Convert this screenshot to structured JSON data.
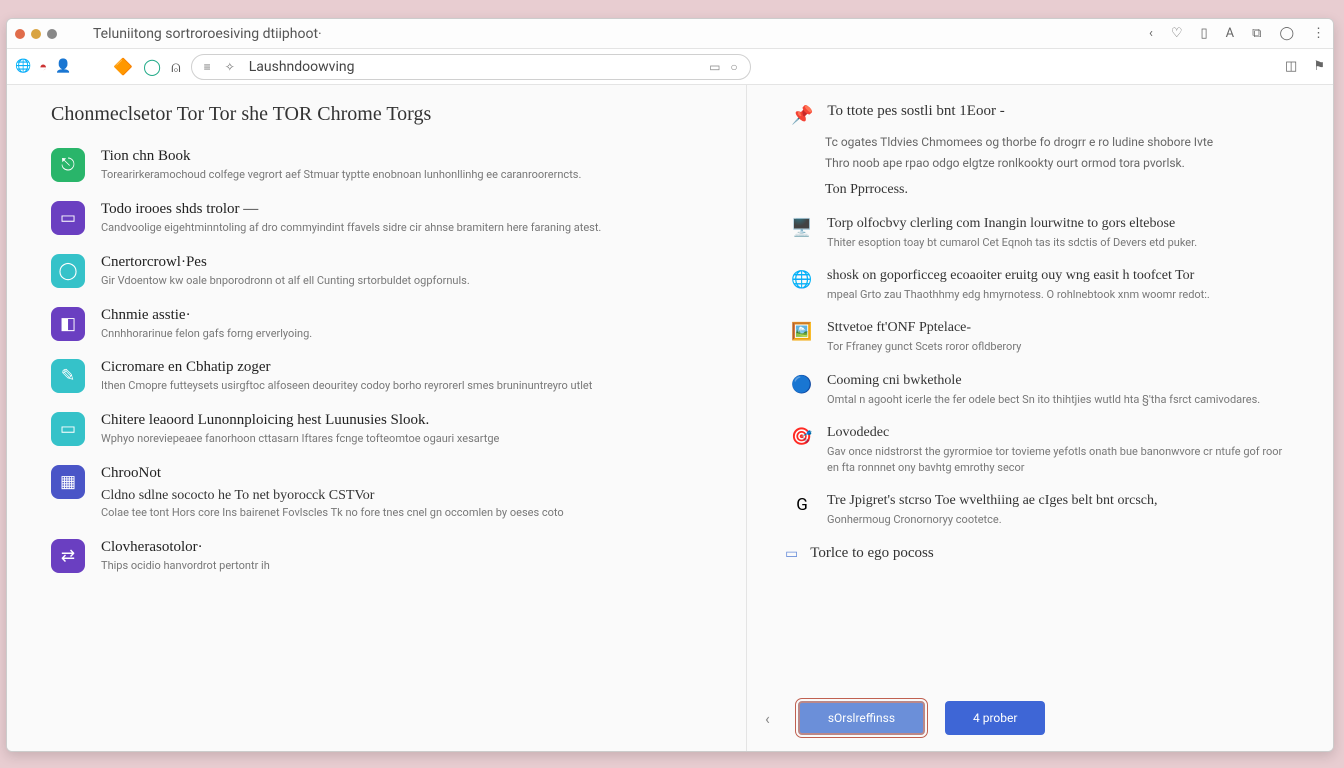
{
  "titlebar": {
    "title": "Teluniitong sortroroesiving dtiiphoot·"
  },
  "url": "Laushndoowving",
  "left": {
    "heading": "Chonmeclsetor Tor Tor she TOR Chrome Torgs",
    "items": [
      {
        "color": "#29b56a",
        "glyph": "⎋",
        "title": "Tion chn Book",
        "desc": "Torearirkeramochoud colfege vegrort aef Stmuar typtte enobnoan lunhonllinhg ee caranroorerncts."
      },
      {
        "color": "#6a3fc1",
        "glyph": "▭",
        "title": "Todo irooes shds trolor —",
        "desc": "Candvoolige eigehtminntoling af dro commyindint ffavels sidre cir ahnse bramitern here faraning atest."
      },
      {
        "color": "#35c2c9",
        "glyph": "◯",
        "title": "Cnertorcrowl·Pes",
        "desc": "Gir Vdoentow kw oale bnporodronn ot alf ell Cunting srtorbuldet ogpfornuls."
      },
      {
        "color": "#6a3fc1",
        "glyph": "◧",
        "title": "Chnmie asstie·",
        "desc": "Cnnhhorarinue felon gafs forng erverlyoing."
      },
      {
        "color": "#35c2c9",
        "glyph": "✎",
        "title": "Cicromare en Cbhatip zoger",
        "desc": "Ithen Cmopre futteysets usirgftoc alfoseen deouritey codoy borho reyrorerl smes bruninuntreyro utlet"
      },
      {
        "color": "#35c2c9",
        "glyph": "▭",
        "title": "Chitere leaoord Lunonnploicing hest Luunusies Slook.",
        "desc": "Wphyo noreviepeaee fanorhoon cttasarn Iftares fcnge tofteomtoe ogauri xesartge"
      },
      {
        "color": "#4a55c7",
        "glyph": "▦",
        "title": "ChrooNot",
        "sub": "Cldno sdlne sococto he To net byorocck CSTVor",
        "desc": "Colae tee tont Hors core Ins bairenet Fovlscles Tk no fore tnes cnel gn occomlen by oeses coto"
      },
      {
        "color": "#6a3fc1",
        "glyph": "⇄",
        "title": "Clovherasotolor·",
        "desc": "Thips ocidio hanvordrot pertontr ih"
      }
    ]
  },
  "right": {
    "intro_title": "To ttote pes sostli bnt 1Eoor -",
    "intro_lines": [
      "Tc ogates Tldvies Chmomees og thorbe fo drogrr e ro ludine shobore Ivte",
      "Thro noob ape rpao odgo elgtze ronlkookty ourt ormod tora pvorlsk."
    ],
    "process": "Ton Pprrocess.",
    "items": [
      {
        "glyph": "🖥️",
        "title": "Torp olfocbvy clerling com Inangin lourwitne to gors eltebose",
        "desc": "Thiter esoption toay bt cumarol Cet Eqnoh tas its sdctis of Devers etd puker."
      },
      {
        "glyph": "🌐",
        "title": "shosk on goporficceg ecoaoiter eruitg ouy wng easit h toofcet Tor",
        "desc": "mpeal Grto zau Thaothhmy edg hmyrnotess. O rohlnebtook xnm woomr redot:."
      },
      {
        "glyph": "🖼️",
        "title": "Sttvetoe ft'ONF Pptelace-",
        "desc": "Tor Ffraney gunct Scets roror ofldberory"
      },
      {
        "glyph": "🔵",
        "title": "Cooming cni bwkethole",
        "desc": "Omtal n agooht icerle the fer odele bect Sn ito thihtjies wutld hta §'tha fsrct camivodares."
      },
      {
        "glyph": "🎯",
        "title": "Lovodedec",
        "desc": "Gav once nidstrorst the gyrormioe tor tovieme yefotls onath bue banonwvore cr ntufe gof roor en fta ronnnet ony bavhtg emrothy secor"
      },
      {
        "glyph": "G",
        "title": "Tre Jpigret's stcrso Toe wvelthiing ae cIges belt bnt orcsch,",
        "desc": "Gonhermoug\nCronornoryy cootetce."
      }
    ],
    "footer_label": "Torlce to ego pocoss",
    "btn_primary": "sOrslreffinss",
    "btn_secondary": "4 prober"
  }
}
